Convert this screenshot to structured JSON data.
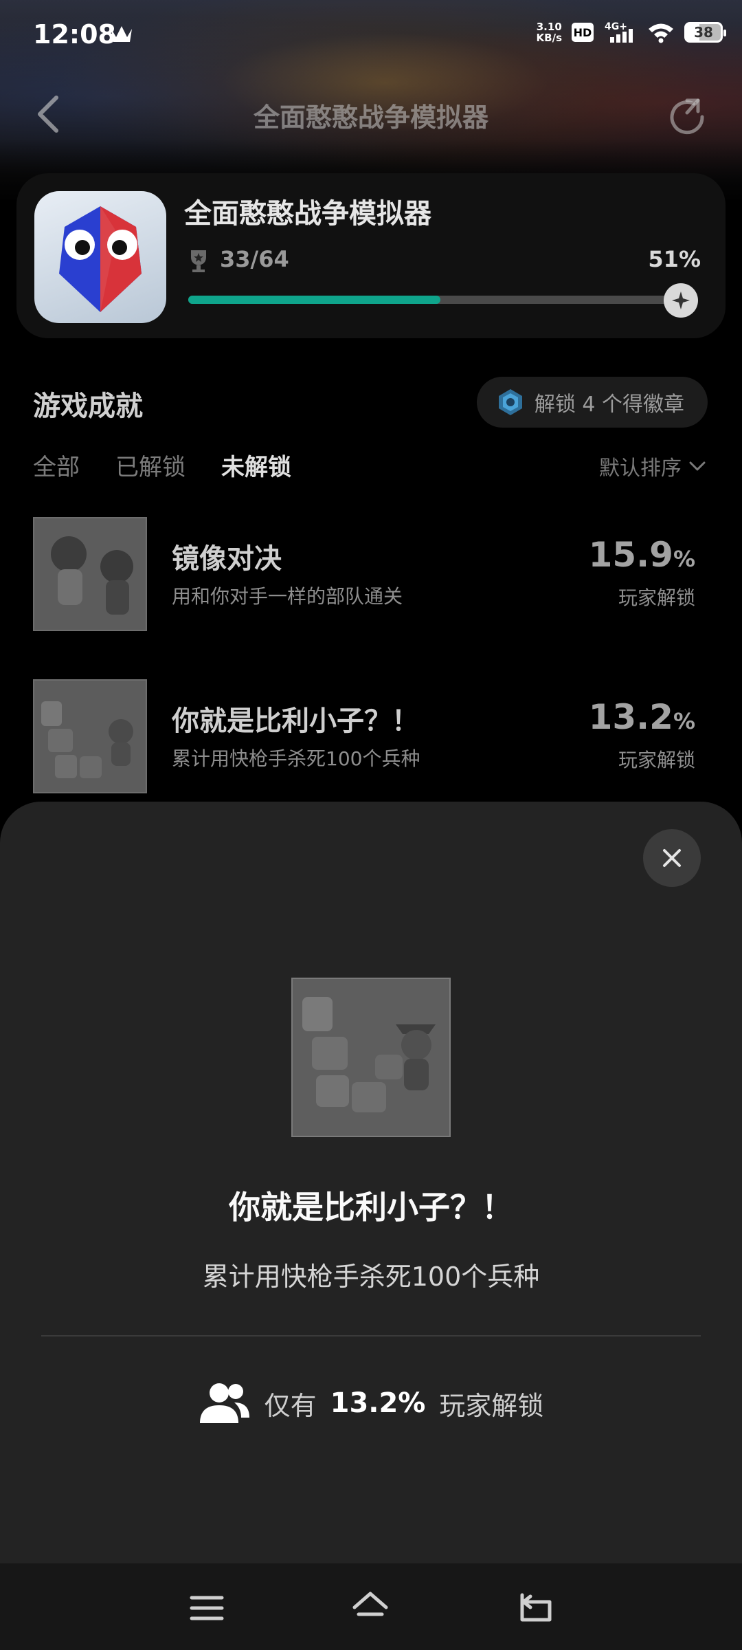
{
  "status_bar": {
    "time": "12:08",
    "net_speed_value": "3.10",
    "net_speed_unit": "KB/s",
    "hd_label": "HD",
    "network_label": "4G+",
    "battery": "38"
  },
  "header": {
    "title": "全面憨憨战争模拟器"
  },
  "game": {
    "name": "全面憨憨战争模拟器",
    "trophy_count": "33/64",
    "percent": "51%",
    "progress": 0.51
  },
  "section": {
    "title": "游戏成就",
    "badge_text": "解锁 4 个得徽章",
    "tabs": [
      "全部",
      "已解锁",
      "未解锁"
    ],
    "active_tab": 2,
    "sort_label": "默认排序"
  },
  "achievements": [
    {
      "name": "镜像对决",
      "desc": "用和你对手一样的部队通关",
      "percent": "15.9",
      "unit": "%",
      "label": "玩家解锁"
    },
    {
      "name": "你就是比利小子？！",
      "desc": "累计用快枪手杀死100个兵种",
      "percent": "13.2",
      "unit": "%",
      "label": "玩家解锁"
    }
  ],
  "detail": {
    "name": "你就是比利小子？！",
    "desc": "累计用快枪手杀死100个兵种",
    "stat_prefix": "仅有",
    "stat_value": "13.2%",
    "stat_suffix": "玩家解锁"
  },
  "colors": {
    "accent": "#0fa58c",
    "sheet_bg": "#232323",
    "card_bg": "#111111"
  }
}
